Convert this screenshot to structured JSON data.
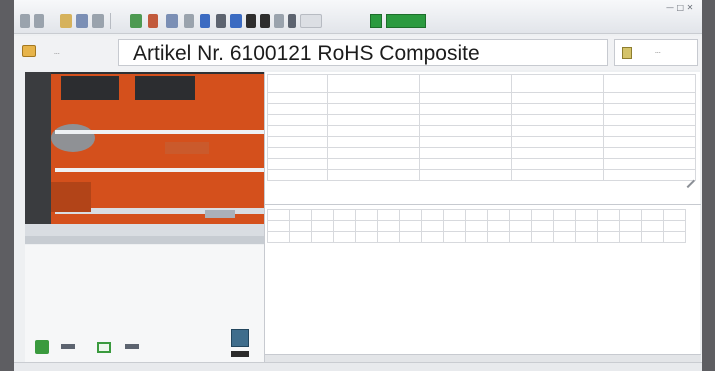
{
  "header": {
    "title": "Artikel Nr. 6100121  RoHS Composite",
    "left_label": "...",
    "right_label": "..."
  },
  "colors": {
    "accent_green": "#2b9a3f",
    "window_bg": "#eef0f2",
    "photo_orange": "#d4501c"
  },
  "icons": {
    "toolbar": [
      "back-icon",
      "forward-icon",
      "folder-icon",
      "save-icon",
      "print-icon",
      "measure-icon",
      "chart-icon",
      "camera-icon",
      "settings-icon",
      "help-icon"
    ],
    "green_buttons": [
      "ok-icon",
      "result-icon"
    ],
    "bottom_panel": [
      "download-icon",
      "display-icon",
      "layers-icon"
    ]
  }
}
